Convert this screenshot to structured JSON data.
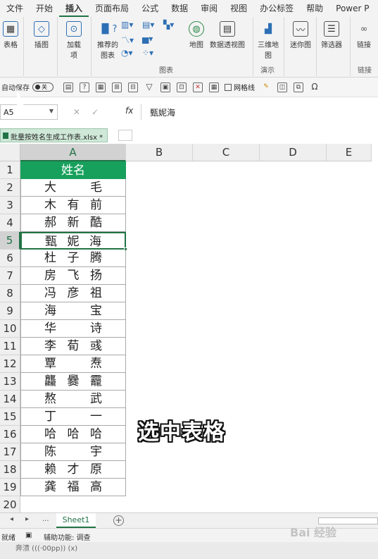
{
  "ribbon_tabs": [
    "文件",
    "开始",
    "插入",
    "页面布局",
    "公式",
    "数据",
    "审阅",
    "视图",
    "办公标签",
    "帮助",
    "Power P"
  ],
  "active_tab": "插入",
  "ribbon": {
    "table": "表格",
    "illustrations": "插图",
    "addins": "加载\n项",
    "recommended_charts": "推荐的\n图表",
    "maps": "地图",
    "pivot_chart": "数据透视图",
    "threed_map": "三维地\n图",
    "sparklines": "迷你图",
    "filters": "筛选器",
    "link": "链接",
    "group_charts": "图表",
    "group_tours": "演示",
    "group_links": "链接"
  },
  "qat": {
    "autosave_label": "自动保存",
    "autosave_state": "关",
    "gridlines_label": "网格线"
  },
  "formula_bar": {
    "name_box": "A5",
    "fx": "fx",
    "value": "甄妮海"
  },
  "workbook_tab": "批量按姓名生成工作表.xlsx *",
  "columns": [
    "A",
    "B",
    "C",
    "D",
    "E"
  ],
  "header_cell": "姓名",
  "rows": [
    [
      "大",
      "",
      "毛"
    ],
    [
      "木",
      "有",
      "前"
    ],
    [
      "郝",
      "新",
      "酷"
    ],
    [
      "甄",
      "妮",
      "海"
    ],
    [
      "杜",
      "子",
      "腾"
    ],
    [
      "房",
      "飞",
      "扬"
    ],
    [
      "冯",
      "彦",
      "祖"
    ],
    [
      "海",
      "",
      "宝"
    ],
    [
      "华",
      "",
      "诗"
    ],
    [
      "李",
      "荀",
      "彧"
    ],
    [
      "覃",
      "",
      "焘"
    ],
    [
      "龘",
      "爨",
      "龗"
    ],
    [
      "熬",
      "",
      "武"
    ],
    [
      "丁",
      "",
      "一"
    ],
    [
      "哈",
      "哈",
      "哈"
    ],
    [
      "陈",
      "",
      "宇"
    ],
    [
      "赖",
      "才",
      "原"
    ],
    [
      "龚",
      "福",
      "高"
    ]
  ],
  "row_numbers": [
    "1",
    "2",
    "3",
    "4",
    "5",
    "6",
    "7",
    "8",
    "9",
    "10",
    "11",
    "12",
    "13",
    "14",
    "15",
    "16",
    "17",
    "18",
    "19",
    "20"
  ],
  "active_row": "5",
  "caption": "选中表格",
  "sheet_tab": "Sheet1",
  "sheet_nav": {
    "prev": "◂",
    "next": "▸",
    "more": "..."
  },
  "status": {
    "ready": "就绪",
    "accessibility": "辅助功能: 调查"
  },
  "watermark": "Bai 经验",
  "taskbar_text": "奔溃 (((·00pp)) (x)",
  "accent_color": "#217346",
  "header_fill": "#17a05c"
}
